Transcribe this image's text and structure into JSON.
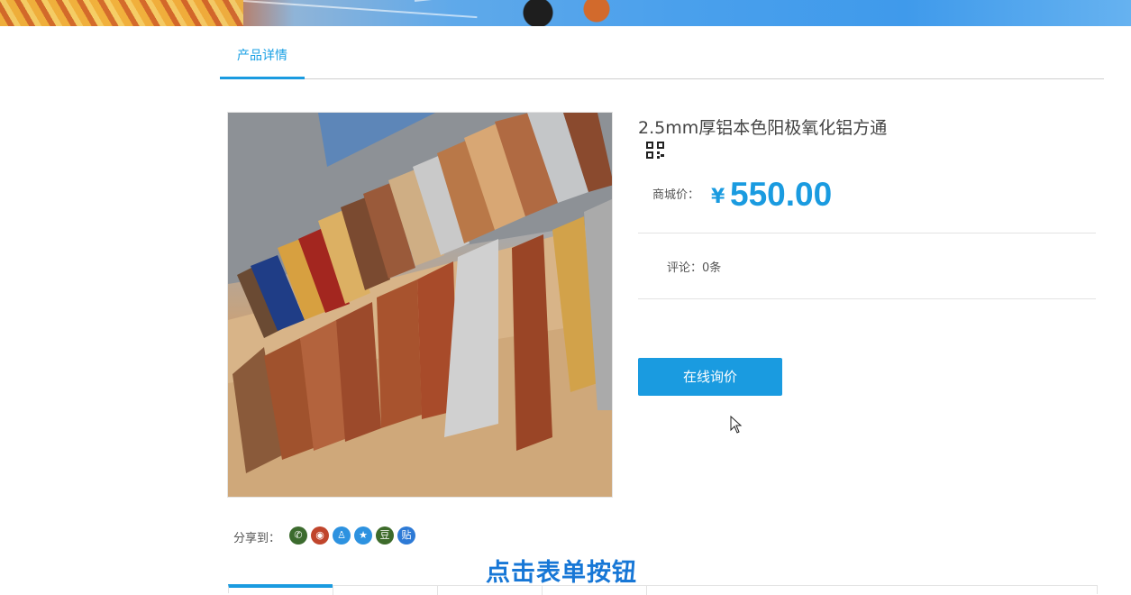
{
  "tabs": {
    "active_label": "产品详情"
  },
  "product": {
    "title": "2.5mm厚铝本色阳极氧化铝方通",
    "price_label": "商城价：",
    "price_currency": "¥",
    "price_value": "550.00",
    "review_text": "评论：0条",
    "inquiry_button": "在线询价"
  },
  "share": {
    "label": "分享到：",
    "icons": [
      {
        "name": "wechat-icon",
        "glyph": "✆",
        "color": "#3c6b2e"
      },
      {
        "name": "weibo-icon",
        "glyph": "◉",
        "color": "#c0452c"
      },
      {
        "name": "qq-icon",
        "glyph": "♙",
        "color": "#2d92e0"
      },
      {
        "name": "qzone-icon",
        "glyph": "★",
        "color": "#2d92e0"
      },
      {
        "name": "douban-icon",
        "glyph": "豆",
        "color": "#3d6b2b"
      },
      {
        "name": "tieba-icon",
        "glyph": "贴",
        "color": "#2d7ad6"
      }
    ]
  },
  "caption": "点击表单按钮",
  "colors": {
    "accent": "#1a9be0",
    "caption": "#1777d6"
  }
}
